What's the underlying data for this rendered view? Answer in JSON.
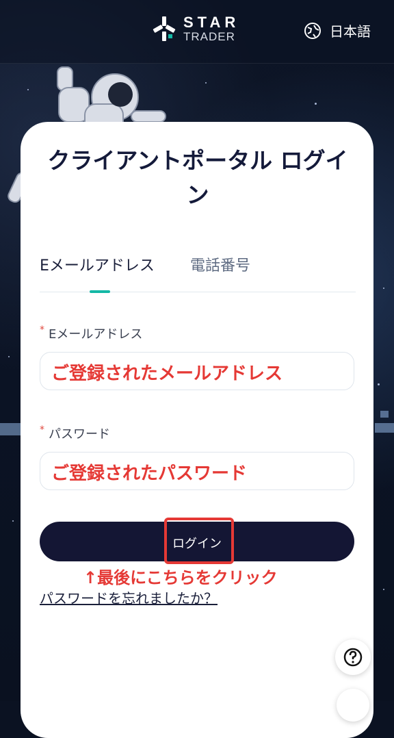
{
  "header": {
    "brand_line1": "STAR",
    "brand_line2": "TRADER",
    "language": "日本語",
    "globe_icon": "globe-icon"
  },
  "card": {
    "title": "クライアントポータル ログイン",
    "tabs": [
      {
        "label": "Eメールアドレス",
        "active": true
      },
      {
        "label": "電話番号",
        "active": false
      }
    ],
    "email": {
      "label": "Eメールアドレス",
      "required_mark": "*",
      "value": "ご登録されたメールアドレス"
    },
    "password": {
      "label": "パスワード",
      "required_mark": "*",
      "value": "ご登録されたパスワード"
    },
    "login_button": "ログイン",
    "annotation": "↑最後にこちらをクリック",
    "forgot_link": "パスワードを忘れましたか？"
  },
  "colors": {
    "accent": "#14b8a6",
    "button": "#141634",
    "annotation": "#e53935",
    "background": "#0b1222"
  },
  "help_icon": "question-icon"
}
